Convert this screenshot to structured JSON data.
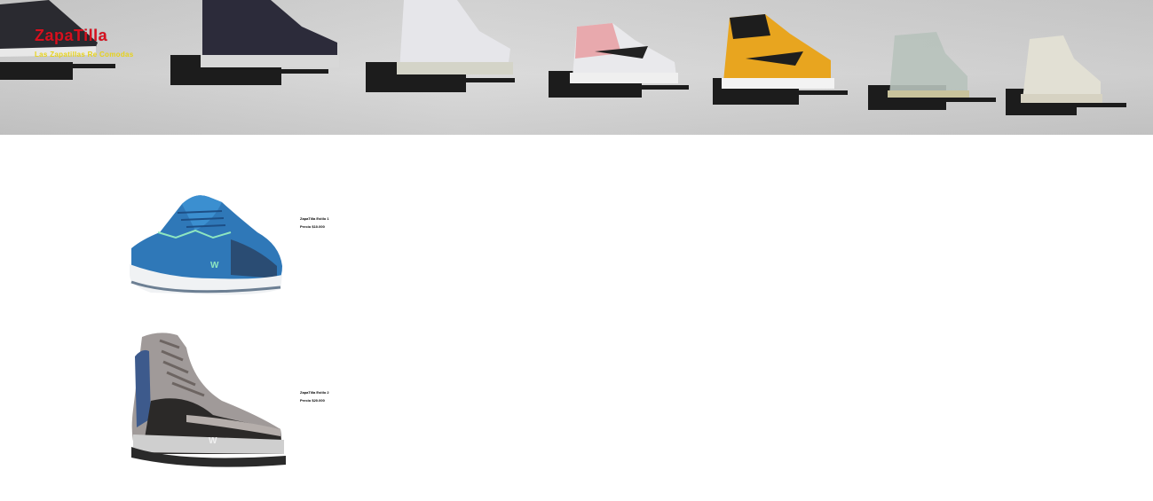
{
  "header": {
    "brand": "ZapaTilla",
    "tagline": "Las Zapatillas Re Comodas"
  },
  "products": [
    {
      "name": "ZapaTilla Estilo 1",
      "price": "Precio $10.000",
      "icon": "blue-sneaker-image"
    },
    {
      "name": "ZapaTilla Estilo 2",
      "price": "Precio $20.000",
      "icon": "grey-hiking-boot-image"
    }
  ]
}
